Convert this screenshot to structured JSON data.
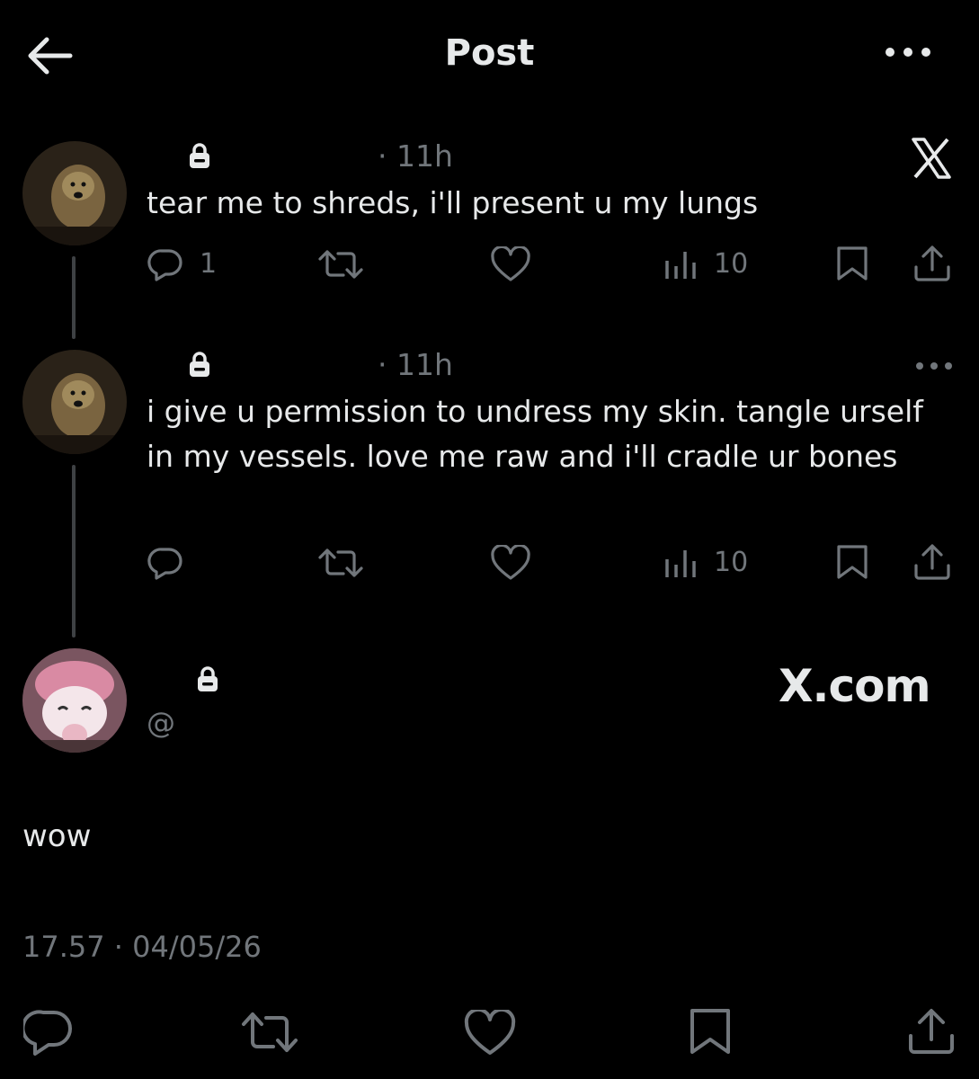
{
  "header": {
    "title": "Post"
  },
  "tweets": [
    {
      "time": "· 11h",
      "text": "tear me to shreds, i'll present u my lungs",
      "reply_count": "1",
      "views": "10"
    },
    {
      "time": "· 11h",
      "text": "i give u permission to undress my skin. tangle urself in my vessels. love me raw and i'll cradle ur bones",
      "reply_count": "",
      "views": "10"
    }
  ],
  "main_post": {
    "handle": "@",
    "text": "wow",
    "timestamp": "17.57 · 04/05/26"
  },
  "watermark": {
    "text": "X.com"
  },
  "colors": {
    "background": "#000000",
    "text": "#e7e9ea",
    "muted": "#71767b",
    "thread_line": "#3e4144"
  },
  "icons": [
    "back-arrow-icon",
    "more-icon",
    "lock-icon",
    "x-logo-icon",
    "reply-icon",
    "retweet-icon",
    "like-icon",
    "views-icon",
    "bookmark-icon",
    "share-icon"
  ]
}
